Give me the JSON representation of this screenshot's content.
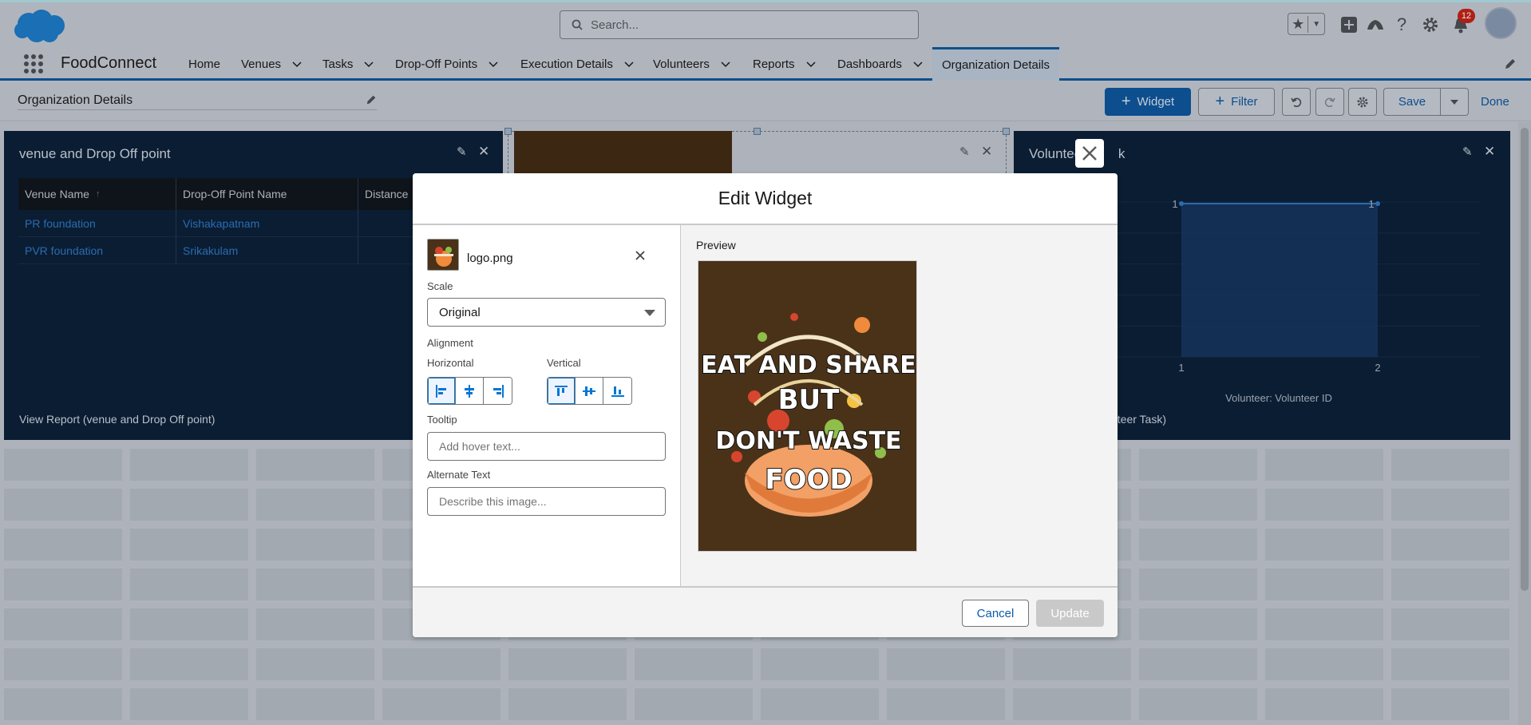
{
  "header": {
    "search_placeholder": "Search...",
    "notification_count": "12"
  },
  "nav": {
    "app_name": "FoodConnect",
    "items": [
      {
        "label": "Home"
      },
      {
        "label": "Venues"
      },
      {
        "label": "Tasks"
      },
      {
        "label": "Drop-Off Points"
      },
      {
        "label": "Execution Details"
      },
      {
        "label": "Volunteers"
      },
      {
        "label": "Reports"
      },
      {
        "label": "Dashboards"
      },
      {
        "label": "Organization Details"
      }
    ]
  },
  "toolbar": {
    "title": "Organization Details",
    "widget_label": "Widget",
    "filter_label": "Filter",
    "save_label": "Save",
    "done_label": "Done"
  },
  "widgets": {
    "venue": {
      "title": "venue and Drop Off point",
      "columns": [
        "Venue Name",
        "Drop-Off Point Name",
        "Distance"
      ],
      "rows": [
        [
          "PR foundation",
          "Vishakapatnam",
          ""
        ],
        [
          "PVR foundation",
          "Srikakulam",
          ""
        ]
      ],
      "footer": "View Report (venue and Drop Off point)"
    },
    "volunteer": {
      "title_visible": "Volunteer",
      "title_tail": "k",
      "footer_visible": "nteer Task)",
      "chart_data": {
        "type": "area",
        "x": [
          1,
          2
        ],
        "values": [
          1,
          1
        ],
        "xlabel": "Volunteer: Volunteer ID",
        "x_ticks": [
          "1",
          "2"
        ],
        "data_labels": [
          "1",
          "1"
        ]
      }
    }
  },
  "modal": {
    "title": "Edit Widget",
    "file_name": "logo.png",
    "scale_label": "Scale",
    "scale_value": "Original",
    "alignment_label": "Alignment",
    "horizontal_label": "Horizontal",
    "vertical_label": "Vertical",
    "tooltip_label": "Tooltip",
    "tooltip_placeholder": "Add hover text...",
    "alt_label": "Alternate Text",
    "alt_placeholder": "Describe this image...",
    "preview_label": "Preview",
    "preview_text": [
      "EAT AND SHARE",
      "BUT",
      "DON'T WASTE",
      "FOOD"
    ],
    "cancel_label": "Cancel",
    "update_label": "Update"
  }
}
